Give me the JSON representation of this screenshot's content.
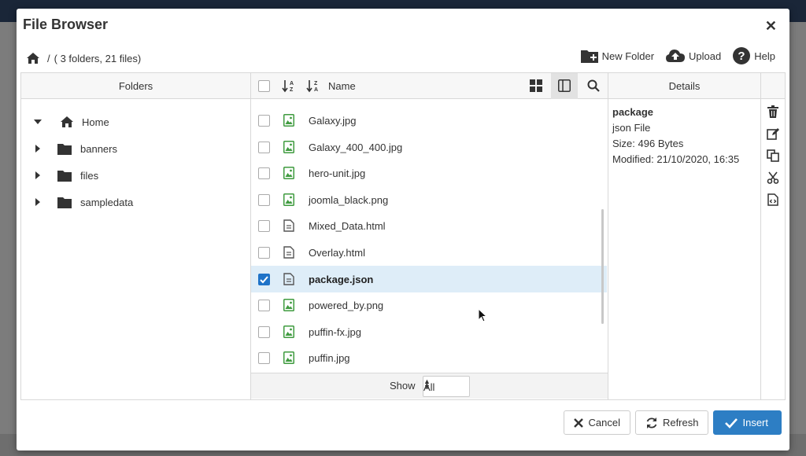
{
  "modal": {
    "title": "File Browser"
  },
  "breadcrumb": {
    "separator": "/",
    "summary": "( 3 folders, 21 files)"
  },
  "toolbar": {
    "new_folder": "New Folder",
    "upload": "Upload",
    "help": "Help"
  },
  "folders_panel": {
    "header": "Folders",
    "tree": [
      {
        "label": "Home",
        "icon": "home-icon",
        "expanded": true
      },
      {
        "label": "banners",
        "icon": "folder-icon"
      },
      {
        "label": "files",
        "icon": "folder-icon"
      },
      {
        "label": "sampledata",
        "icon": "folder-icon"
      }
    ]
  },
  "files_panel": {
    "header_name": "Name",
    "files": [
      {
        "name": "Galaxy.jpg",
        "type": "image",
        "selected": false
      },
      {
        "name": "Galaxy_400_400.jpg",
        "type": "image",
        "selected": false
      },
      {
        "name": "hero-unit.jpg",
        "type": "image",
        "selected": false
      },
      {
        "name": "joomla_black.png",
        "type": "image",
        "selected": false
      },
      {
        "name": "Mixed_Data.html",
        "type": "document",
        "selected": false
      },
      {
        "name": "Overlay.html",
        "type": "document",
        "selected": false
      },
      {
        "name": "package.json",
        "type": "document",
        "selected": true
      },
      {
        "name": "powered_by.png",
        "type": "image",
        "selected": false
      },
      {
        "name": "puffin-fx.jpg",
        "type": "image",
        "selected": false
      },
      {
        "name": "puffin.jpg",
        "type": "image",
        "selected": false
      }
    ],
    "footer": {
      "show_label": "Show",
      "show_value": "All"
    }
  },
  "details_panel": {
    "header": "Details",
    "name": "package",
    "file_type": "json File",
    "size": "Size: 496 Bytes",
    "modified": "Modified: 21/10/2020, 16:35"
  },
  "footer": {
    "cancel": "Cancel",
    "refresh": "Refresh",
    "insert": "Insert"
  },
  "colors": {
    "accent": "#2d7ec4",
    "selected_row": "#deedf8",
    "image_icon": "#3f9b3f"
  }
}
